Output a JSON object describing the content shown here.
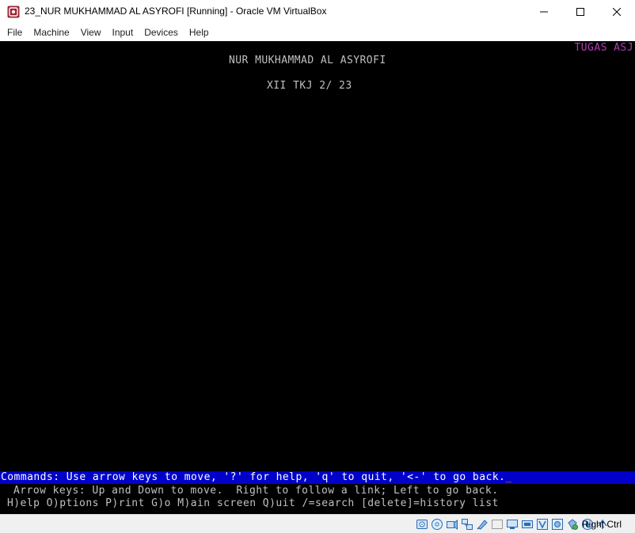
{
  "window": {
    "title": "23_NUR MUKHAMMAD AL ASYROFI [Running] - Oracle VM VirtualBox",
    "controls": [
      "minimize-icon",
      "maximize-icon",
      "close-icon"
    ]
  },
  "menu": {
    "items": [
      "File",
      "Machine",
      "View",
      "Input",
      "Devices",
      "Help"
    ]
  },
  "terminal": {
    "corner_label": "TUGAS ASJ",
    "page_name": "NUR MUKHAMMAD AL ASYROFI",
    "page_class": "XII TKJ 2/ 23",
    "commands_line": "Commands: Use arrow keys to move, '?' for help, 'q' to quit, '<-' to go back.",
    "cursor": "_",
    "help_line_1": "Arrow keys: Up and Down to move.  Right to follow a link; Left to go back.",
    "help_line_2": "H)elp O)ptions P)rint G)o M)ain screen Q)uit /=search [delete]=history list",
    "colors": {
      "background": "#000000",
      "text": "#c0c0c0",
      "accent": "#b43cb4",
      "command_bar": "#0000c8",
      "cursor": "#e08000"
    }
  },
  "statusbar": {
    "icons": [
      "hard-disk-icon",
      "optical-drive-icon",
      "audio-icon",
      "network-icon",
      "usb-icon",
      "shared-folder-icon",
      "display-icon",
      "video-capture-icon",
      "recording-icon",
      "virtualization-icon",
      "cpu-icon",
      "mouse-integration-icon",
      "keyboard-icon"
    ],
    "host_key": "Right Ctrl"
  }
}
